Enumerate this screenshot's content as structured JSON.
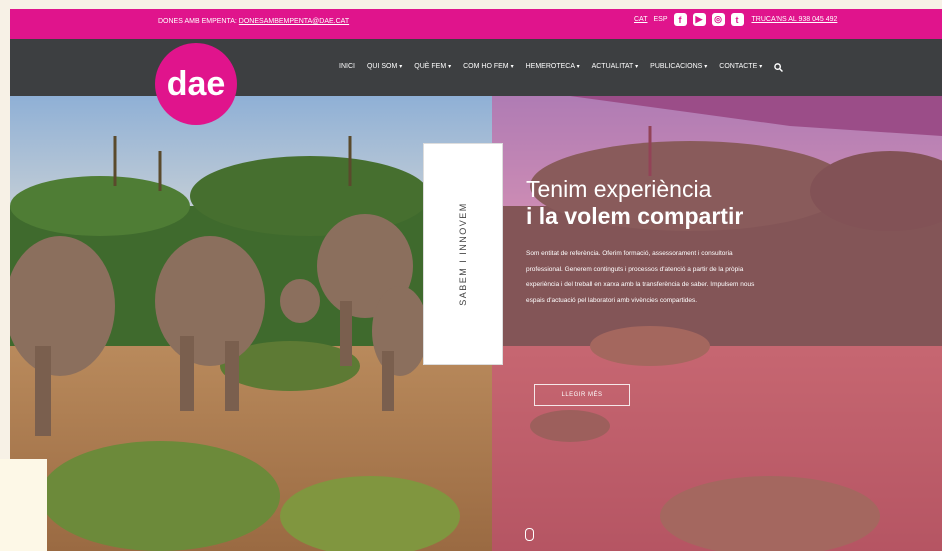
{
  "topbar": {
    "contact_label": "DONES AMB EMPENTA:",
    "email": "DONESAMBEMPENTA@DAE.CAT",
    "languages": [
      "CAT",
      "ESP"
    ],
    "social_icons": [
      "facebook-icon",
      "youtube-icon",
      "instagram-icon",
      "twitter-icon"
    ],
    "phone": "TRUCA'NS AL 938 045 492"
  },
  "navbar": {
    "logo_text": "dae",
    "menu": [
      {
        "label": "INICI",
        "has_dropdown": false
      },
      {
        "label": "QUI SOM",
        "has_dropdown": true
      },
      {
        "label": "QUÈ FEM",
        "has_dropdown": true
      },
      {
        "label": "COM HO FEM",
        "has_dropdown": true
      },
      {
        "label": "HEMEROTECA",
        "has_dropdown": true
      },
      {
        "label": "ACTUALITAT",
        "has_dropdown": true
      },
      {
        "label": "PUBLICACIONS",
        "has_dropdown": true
      },
      {
        "label": "CONTACTE",
        "has_dropdown": true
      }
    ]
  },
  "hero": {
    "tab_label": "SABEM I INNOVEM",
    "headline_line1": "Tenim experiència",
    "headline_line2": "i la volem compartir",
    "description": "Som entitat de referència. Oferim formació, assessorament i consultoria professional. Generem continguts i processos d'atenció a partir de la pròpia experiència i del treball en xarxa amb la transferència de saber. Impulsem nous espais d'actuació pel laboratori amb vivències compartides.",
    "read_more": "LLEGIR MÉS"
  },
  "colors": {
    "brand_pink": "#e0148c",
    "navbar_bg": "#3d3f41"
  }
}
